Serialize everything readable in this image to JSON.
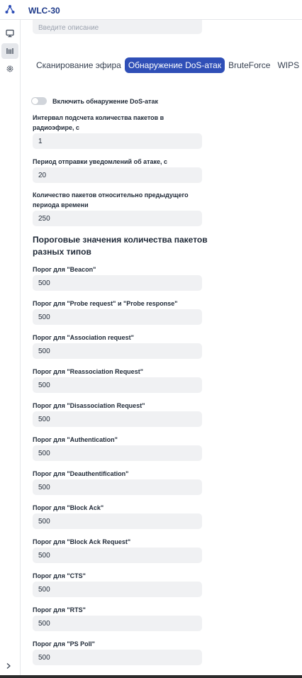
{
  "header": {
    "app_title": "WLC-30"
  },
  "sidebar": {
    "items": [
      {
        "icon": "monitor-icon",
        "active": false
      },
      {
        "icon": "signal-bars-icon",
        "active": true
      },
      {
        "icon": "gear-icon",
        "active": false
      }
    ],
    "expand_icon": "chevron-right-icon"
  },
  "description": {
    "placeholder": "Введите описание"
  },
  "tabs": [
    {
      "label": "Сканирование эфира",
      "active": false
    },
    {
      "label": "Обнаружение DoS-атак",
      "active": true
    },
    {
      "label": "BruteForce",
      "active": false
    },
    {
      "label": "WIPS",
      "active": false
    }
  ],
  "toggle": {
    "label": "Включить обнаружение DoS-атак",
    "enabled": false
  },
  "fields": [
    {
      "label": "Интервал подсчета количества пакетов в радиоэфире, с",
      "value": "1"
    },
    {
      "label": "Период отправки уведомлений об атаке, с",
      "value": "20"
    },
    {
      "label": "Количество пакетов относительно предыдущего периода времени",
      "value": "250"
    }
  ],
  "thresholds": {
    "title": "Пороговые значения количества пакетов разных типов",
    "items": [
      {
        "label": "Порог для \"Beacon\"",
        "value": "500"
      },
      {
        "label": "Порог для \"Probe request\" и \"Probe response\"",
        "value": "500"
      },
      {
        "label": "Порог для \"Association request\"",
        "value": "500"
      },
      {
        "label": "Порог для \"Reassociation Request\"",
        "value": "500"
      },
      {
        "label": "Порог для \"Disassociation Request\"",
        "value": "500"
      },
      {
        "label": "Порог для \"Authentication\"",
        "value": "500"
      },
      {
        "label": "Порог для \"Deauthentification\"",
        "value": "500"
      },
      {
        "label": "Порог для \"Block Ack\"",
        "value": "500"
      },
      {
        "label": "Порог для \"Block Ack Request\"",
        "value": "500"
      },
      {
        "label": "Порог для \"CTS\"",
        "value": "500"
      },
      {
        "label": "Порог для \"RTS\"",
        "value": "500"
      },
      {
        "label": "Порог для \"PS Poll\"",
        "value": "500"
      }
    ]
  },
  "colors": {
    "accent": "#2f4fb7",
    "title": "#1e3a8a",
    "input_bg": "#f0f1f3"
  }
}
